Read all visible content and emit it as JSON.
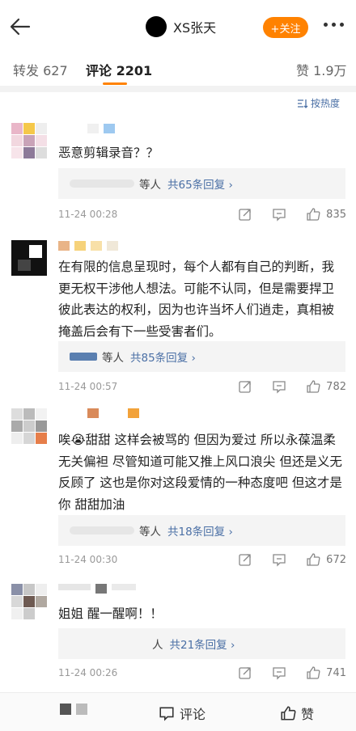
{
  "header": {
    "account_name": "XS张天",
    "follow_label": "+关注"
  },
  "tabs": [
    {
      "label": "转发 627"
    },
    {
      "label": "评论 2201"
    },
    {
      "label": "赞 1.9万"
    }
  ],
  "sort_label": "按热度",
  "comments": [
    {
      "text": "恶意剪辑录音？？",
      "replies_who": "等人",
      "replies_count": "共65条回复 ›",
      "time": "11-24 00:28",
      "likes": "835"
    },
    {
      "text": "在有限的信息呈现时，每个人都有自己的判断，我更无权干涉他人想法。可能不认同，但是需要捍卫彼此表达的权利，因为也许当坏人们逍走，真相被掩盖后会有下一些受害者们。",
      "replies_who": "等人",
      "replies_count": "共85条回复 ›",
      "time": "11-24 00:57",
      "likes": "782"
    },
    {
      "text": "唉😭甜甜 这样会被骂的 但因为爱过 所以永葆温柔 无关偏袒 尽管知道可能又推上风口浪尖 但还是义无反顾了 这也是你对这段爱情的一种态度吧 但这才是你 甜甜加油",
      "replies_who": "等人",
      "replies_count": "共18条回复 ›",
      "time": "11-24 00:30",
      "likes": "672"
    },
    {
      "text": "姐姐 醒一醒啊！！",
      "replies_who": "人",
      "replies_count": "共21条回复 ›",
      "time": "11-24 00:26",
      "likes": "741"
    }
  ],
  "bottom": {
    "comment_label": "评论",
    "like_label": "赞"
  },
  "colors": {
    "accent": "#ff8200",
    "link": "#4a6fa5"
  }
}
